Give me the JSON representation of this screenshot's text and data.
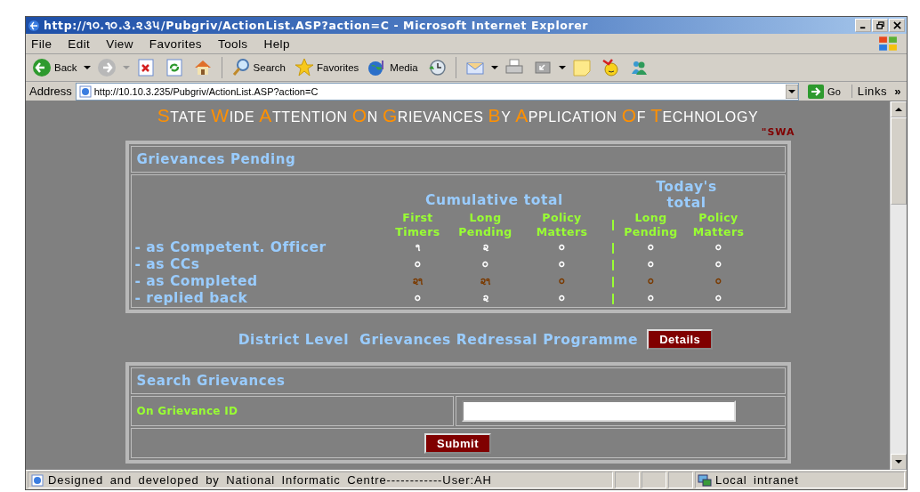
{
  "window": {
    "title": "http://૧૦.૧૦.૩.૨૩૫/Pubgriv/ActionList.ASP?action=C  -  Microsoft Internet Explorer"
  },
  "menu": [
    "File",
    "Edit",
    "View",
    "Favorites",
    "Tools",
    "Help"
  ],
  "toolbar": [
    {
      "kind": "back",
      "label": "Back"
    },
    {
      "kind": "forward"
    },
    {
      "kind": "stop"
    },
    {
      "kind": "refresh"
    },
    {
      "kind": "home"
    },
    {
      "kind": "search",
      "label": "Search"
    },
    {
      "kind": "favorites",
      "label": "Favorites"
    },
    {
      "kind": "media",
      "label": "Media"
    },
    {
      "kind": "history"
    },
    {
      "kind": "mail"
    },
    {
      "kind": "print"
    },
    {
      "kind": "edit"
    },
    {
      "kind": "notes"
    },
    {
      "kind": "smiley"
    },
    {
      "kind": "people"
    }
  ],
  "address": {
    "label": "Address",
    "value": "http://10.10.3.235/Pubgriv/ActionList.ASP?action=C",
    "go": "Go",
    "links": "Links",
    "chevron": "»"
  },
  "page": {
    "heading": "STATE WIDE ATTENTION ON GRIEVANCES BY APPLICATION OF TECHNOLOGY",
    "tagline": "\"SWA",
    "pending": {
      "title": "Grievances Pending",
      "cumulative": "Cumulative total",
      "today": "Today's total",
      "columns": [
        "First Timers",
        "Long Pending",
        "Policy Matters",
        "Long Pending",
        "Policy Matters"
      ],
      "rows": [
        {
          "label": "- as Competent. Officer",
          "highlight": false,
          "values": [
            "૧",
            "૨",
            "૦",
            "૦",
            "૦"
          ]
        },
        {
          "label": "- as CCs",
          "highlight": false,
          "values": [
            "૦",
            "૦",
            "૦",
            "૦",
            "૦"
          ]
        },
        {
          "label": "- as Completed",
          "highlight": true,
          "values": [
            "૨૧",
            "૨૧",
            "૦",
            "૦",
            "૦"
          ]
        },
        {
          "label": "- replied back",
          "highlight": false,
          "values": [
            "૦",
            "૨",
            "૦",
            "૦",
            "૦"
          ]
        }
      ]
    },
    "district": {
      "text": "District Level  Grievances Redressal Programme",
      "button": "Details"
    },
    "search": {
      "title": "Search Grievances",
      "field_label": "On Grievance ID",
      "submit": "Submit"
    }
  },
  "status_bar": {
    "text": "Designed and developed by National Informatic Centre------------User:AH",
    "zone": "Local intranet"
  }
}
